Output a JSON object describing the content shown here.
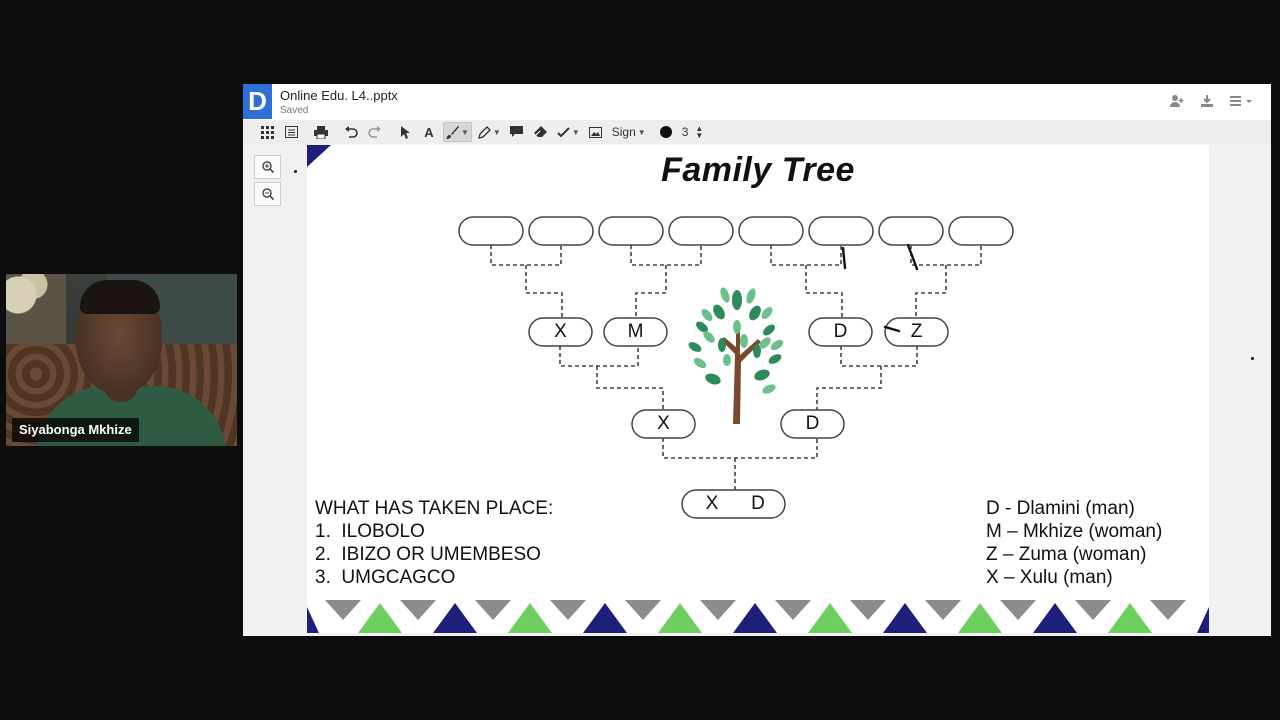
{
  "participant": {
    "name": "Siyabonga Mkhize"
  },
  "app": {
    "logo_letter": "D",
    "doc_title": "Online Edu. L4..pptx",
    "doc_status": "Saved",
    "toolbar": {
      "sign_label": "Sign",
      "stroke_size": "3"
    },
    "icons": {
      "share": "add-person-icon",
      "download": "download-icon",
      "menu": "hamburger-icon"
    },
    "colors": {
      "logo": "#2f6fd6",
      "toolbar": "#eeeeee"
    }
  },
  "slide": {
    "title": "Family Tree",
    "gen1": [
      "",
      "",
      "",
      "",
      "",
      "",
      "",
      ""
    ],
    "gen2": [
      "X",
      "M",
      "D",
      "Z"
    ],
    "gen3": [
      "X",
      "D"
    ],
    "gen4": [
      "X",
      "D"
    ],
    "events": {
      "heading": "WHAT HAS TAKEN PLACE:",
      "items": [
        "1.  ILOBOLO",
        "2.  IBIZO OR UMEMBESO",
        "3.  UMGCAGCO"
      ]
    },
    "legend": [
      "D - Dlamini (man)",
      "M – Mkhize (woman)",
      "Z – Zuma (woman)",
      "X – Xulu (man)"
    ],
    "colors": {
      "navy": "#1e1f7a",
      "green": "#6ccf5e",
      "grey": "#8c8c8c",
      "trunk": "#7a4a2e",
      "leaf_dark": "#2d8a5a",
      "leaf_light": "#6cc08a"
    }
  }
}
